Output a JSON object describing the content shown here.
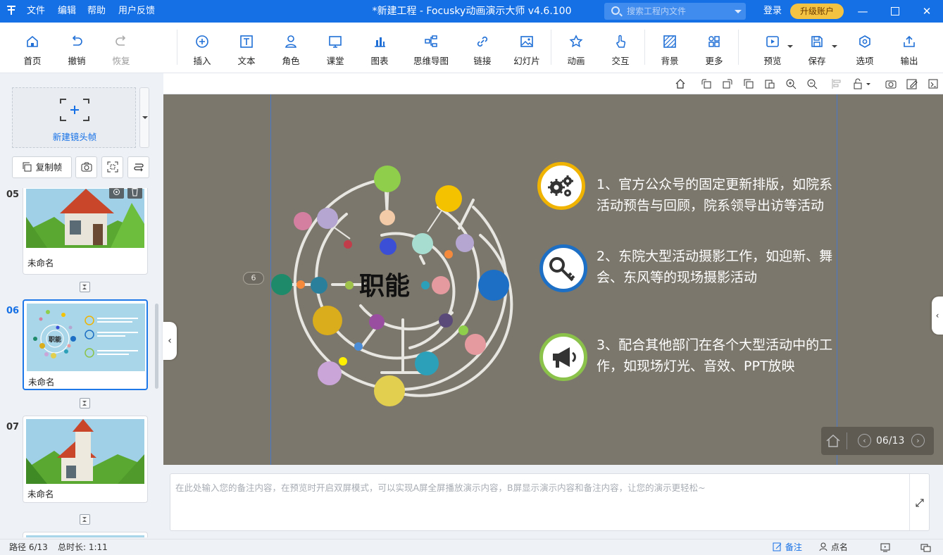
{
  "titlebar": {
    "menus": [
      "文件",
      "编辑",
      "帮助",
      "用户反馈"
    ],
    "title": "*新建工程 - Focusky动画演示大师  v4.6.100",
    "search_placeholder": "搜索工程内文件",
    "login": "登录",
    "upgrade": "升级账户"
  },
  "toolbar": {
    "home": "首页",
    "undo": "撤销",
    "redo": "恢复",
    "insert": "插入",
    "text": "文本",
    "role": "角色",
    "classroom": "课堂",
    "chart": "图表",
    "mindmap": "思维导图",
    "link": "链接",
    "slide": "幻灯片",
    "animation": "动画",
    "interact": "交互",
    "background": "背景",
    "more": "更多",
    "preview": "预览",
    "save": "保存",
    "options": "选项",
    "export": "输出"
  },
  "leftpanel": {
    "new_frame": "新建镜头帧",
    "copy_frame": "复制帧",
    "slides": [
      {
        "num": "05",
        "name": "未命名"
      },
      {
        "num": "06",
        "name": "未命名"
      },
      {
        "num": "07",
        "name": "未命名"
      }
    ],
    "thumb06_title": "职能"
  },
  "stage": {
    "frame_badge": "6",
    "center_title": "职能",
    "items": [
      {
        "text": "1、官方公众号的固定更新排版，如院系活动预告与回顾，院系领导出访等活动",
        "icon": "gears-icon",
        "color": "#f0b400"
      },
      {
        "text": "2、东院大型活动摄影工作，如迎新、舞会、东风等的现场摄影活动",
        "icon": "key-icon",
        "color": "#1c6fc4"
      },
      {
        "text": "3、配合其他部门在各个大型活动中的工作，如现场灯光、音效、PPT放映",
        "icon": "megaphone-icon",
        "color": "#8bc34a"
      }
    ],
    "page_indicator": "06/13"
  },
  "notes": {
    "placeholder": "在此处输入您的备注内容，在预览时开启双屏模式，可以实现A屏全屏播放演示内容，B屏显示演示内容和备注内容，让您的演示更轻松~"
  },
  "statusbar": {
    "path": "路径 6/13",
    "duration": "总时长: 1:11",
    "notes_btn": "备注",
    "rollcall_btn": "点名"
  },
  "colors": {
    "accent": "#1570e6",
    "stage_bg": "#7c776c",
    "upgrade": "#f5c342"
  }
}
